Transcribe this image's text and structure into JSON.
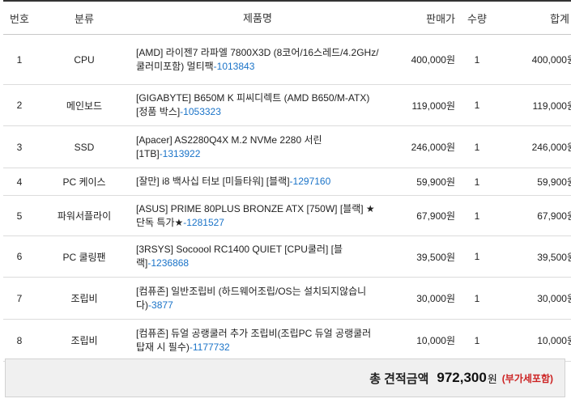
{
  "header": {
    "no": "번호",
    "category": "분류",
    "product": "제품명",
    "price": "판매가",
    "qty": "수량",
    "sum": "합계"
  },
  "rows": [
    {
      "no": "1",
      "category": "CPU",
      "name": "[AMD] 라이젠7 라파엘 7800X3D (8코어/16스레드/4.2GHz/쿨러미포함) 멀티팩",
      "code": "-1013843",
      "price": "400,000원",
      "qty": "1",
      "sum": "400,000원"
    },
    {
      "no": "2",
      "category": "메인보드",
      "name": "[GIGABYTE] B650M K 피씨디렉트 (AMD B650/M-ATX) [정품 박스]",
      "code": "-1053323",
      "price": "119,000원",
      "qty": "1",
      "sum": "119,000원"
    },
    {
      "no": "3",
      "category": "SSD",
      "name": "[Apacer] AS2280Q4X M.2 NVMe 2280 서린 [1TB]",
      "code": "-1313922",
      "price": "246,000원",
      "qty": "1",
      "sum": "246,000원"
    },
    {
      "no": "4",
      "category": "PC 케이스",
      "name": "[잘만] i8 백사십 터보 [미들타워] [블랙]",
      "code": "-1297160",
      "price": "59,900원",
      "qty": "1",
      "sum": "59,900원"
    },
    {
      "no": "5",
      "category": "파워서플라이",
      "name": "[ASUS] PRIME 80PLUS BRONZE ATX [750W] [블랙] ★단독 특가★",
      "code": "-1281527",
      "price": "67,900원",
      "qty": "1",
      "sum": "67,900원"
    },
    {
      "no": "6",
      "category": "PC 쿨링팬",
      "name": "[3RSYS] Socoool RC1400 QUIET [CPU쿨러] [블랙]",
      "code": "-1236868",
      "price": "39,500원",
      "qty": "1",
      "sum": "39,500원"
    },
    {
      "no": "7",
      "category": "조립비",
      "name": "[컴퓨존] 일반조립비 (하드웨어조립/OS는 설치되지않습니다)",
      "code": "-3877",
      "price": "30,000원",
      "qty": "1",
      "sum": "30,000원"
    },
    {
      "no": "8",
      "category": "조립비",
      "name": "[컴퓨존] 듀얼 공랭쿨러 추가 조립비(조립PC 듀얼 공랭쿨러 탑재 시 필수)",
      "code": "-1177732",
      "price": "10,000원",
      "qty": "1",
      "sum": "10,000원"
    }
  ],
  "total": {
    "label": "총 견적금액",
    "value": "972,300",
    "unit": "원",
    "vat": "(부가세포함)"
  }
}
